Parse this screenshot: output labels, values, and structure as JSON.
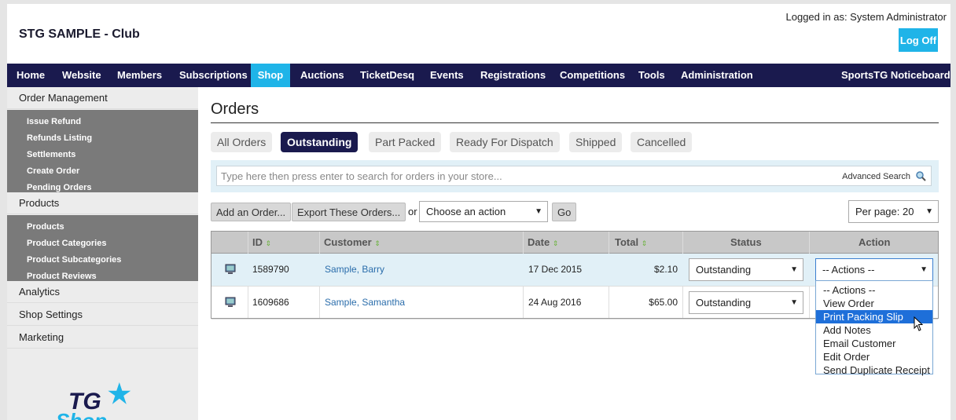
{
  "header": {
    "site_title": "STG SAMPLE - Club",
    "logged_in_text": "Logged in as: System Administrator",
    "logoff_label": "Log Off"
  },
  "nav": {
    "items": [
      "Home",
      "Website",
      "Members",
      "Subscriptions",
      "Shop",
      "Auctions",
      "TicketDesq",
      "Events",
      "Registrations",
      "Competitions",
      "Tools",
      "Administration"
    ],
    "active": "Shop",
    "right_item": "SportsTG Noticeboard"
  },
  "sidebar": {
    "order_management": "Order Management",
    "order_links": [
      "Issue Refund",
      "Refunds Listing",
      "Settlements",
      "Create Order",
      "Pending Orders"
    ],
    "products": "Products",
    "product_links": [
      "Products",
      "Product Categories",
      "Product Subcategories",
      "Product Reviews"
    ],
    "analytics": "Analytics",
    "shop_settings": "Shop Settings",
    "marketing": "Marketing",
    "logo_text": "TG",
    "logo_sub": "Shop"
  },
  "main": {
    "title": "Orders",
    "tabs": [
      "All Orders",
      "Outstanding",
      "Part Packed",
      "Ready For Dispatch",
      "Shipped",
      "Cancelled"
    ],
    "active_tab": "Outstanding",
    "search_placeholder": "Type here then press enter to search for orders in your store...",
    "advanced_search": "Advanced Search",
    "add_order_label": "Add an Order...",
    "export_label": "Export These Orders...",
    "or_text": "or",
    "choose_action": "Choose an action",
    "go_label": "Go",
    "per_page": "Per page: 20"
  },
  "table": {
    "columns": [
      "ID",
      "Customer",
      "Date",
      "Total",
      "Status",
      "Action"
    ],
    "rows": [
      {
        "id": "1589790",
        "customer": "Sample, Barry",
        "date": "17 Dec 2015",
        "total": "$2.10",
        "status": "Outstanding",
        "action": "-- Actions --"
      },
      {
        "id": "1609686",
        "customer": "Sample, Samantha",
        "date": "24 Aug 2016",
        "total": "$65.00",
        "status": "Outstanding",
        "action": ""
      }
    ]
  },
  "action_dropdown": {
    "options": [
      "-- Actions --",
      "View Order",
      "Print Packing Slip",
      "Add Notes",
      "Email Customer",
      "Edit Order",
      "Send Duplicate Receipt"
    ],
    "highlighted": "Print Packing Slip"
  },
  "colors": {
    "nav_bg": "#1a1a4e",
    "accent": "#1fb4e8",
    "sidebar_sub": "#7a7a7a",
    "highlight": "#1e6fd9"
  }
}
